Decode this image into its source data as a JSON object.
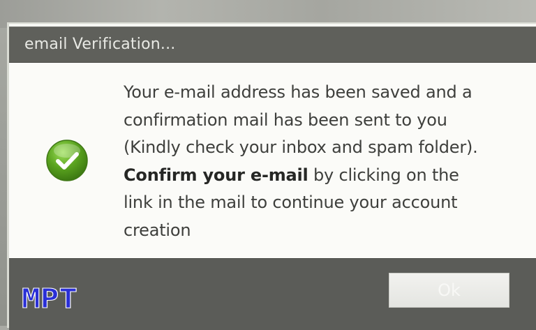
{
  "dialog": {
    "title": "email Verification...",
    "message": {
      "line1": "Your e-mail address has been saved and a",
      "line2": "confirmation mail has been sent to you",
      "line3": "(Kindly check your inbox and spam folder).",
      "bold_text": "Confirm your e-mail",
      "line4_rest": " by clicking on the",
      "line5": "link in the mail to continue your account",
      "line6": "creation"
    },
    "ok_label": "Ok",
    "icon": "checkmark-success-icon"
  },
  "watermark": {
    "text": "MPT",
    "color": "#2a2fd6"
  },
  "colors": {
    "titlebar": "#5f605b",
    "content_bg": "#fbfbf8",
    "footer": "#5b5c58",
    "success_green": "#5aa31f"
  }
}
